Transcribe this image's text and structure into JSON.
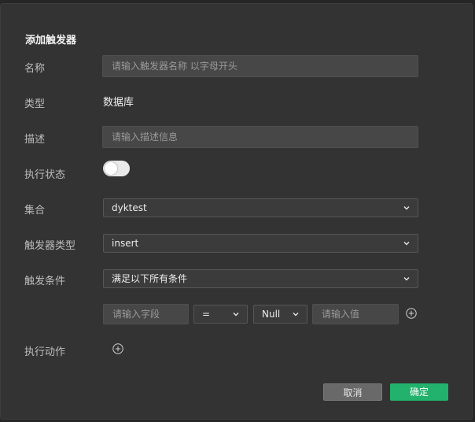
{
  "dialog": {
    "title": "添加触发器"
  },
  "form": {
    "name": {
      "label": "名称",
      "placeholder": "请输入触发器名称 以字母开头",
      "value": ""
    },
    "type": {
      "label": "类型",
      "value": "数据库"
    },
    "description": {
      "label": "描述",
      "placeholder": "请输入描述信息",
      "value": ""
    },
    "status": {
      "label": "执行状态",
      "enabled": false
    },
    "collection": {
      "label": "集合",
      "value": "dyktest"
    },
    "trigger_type": {
      "label": "触发器类型",
      "value": "insert"
    },
    "condition": {
      "label": "触发条件",
      "value": "满足以下所有条件"
    },
    "condition_row": {
      "field_placeholder": "请输入字段",
      "operator": "=",
      "value_type": "Null",
      "value_placeholder": "请输入值"
    },
    "action": {
      "label": "执行动作"
    }
  },
  "buttons": {
    "cancel": "取消",
    "confirm": "确定"
  },
  "colors": {
    "confirm_bg": "#23b26d",
    "cancel_bg": "#696969"
  },
  "icons": {
    "dropdown": "chevron-down-icon",
    "add": "plus-circle-icon"
  }
}
